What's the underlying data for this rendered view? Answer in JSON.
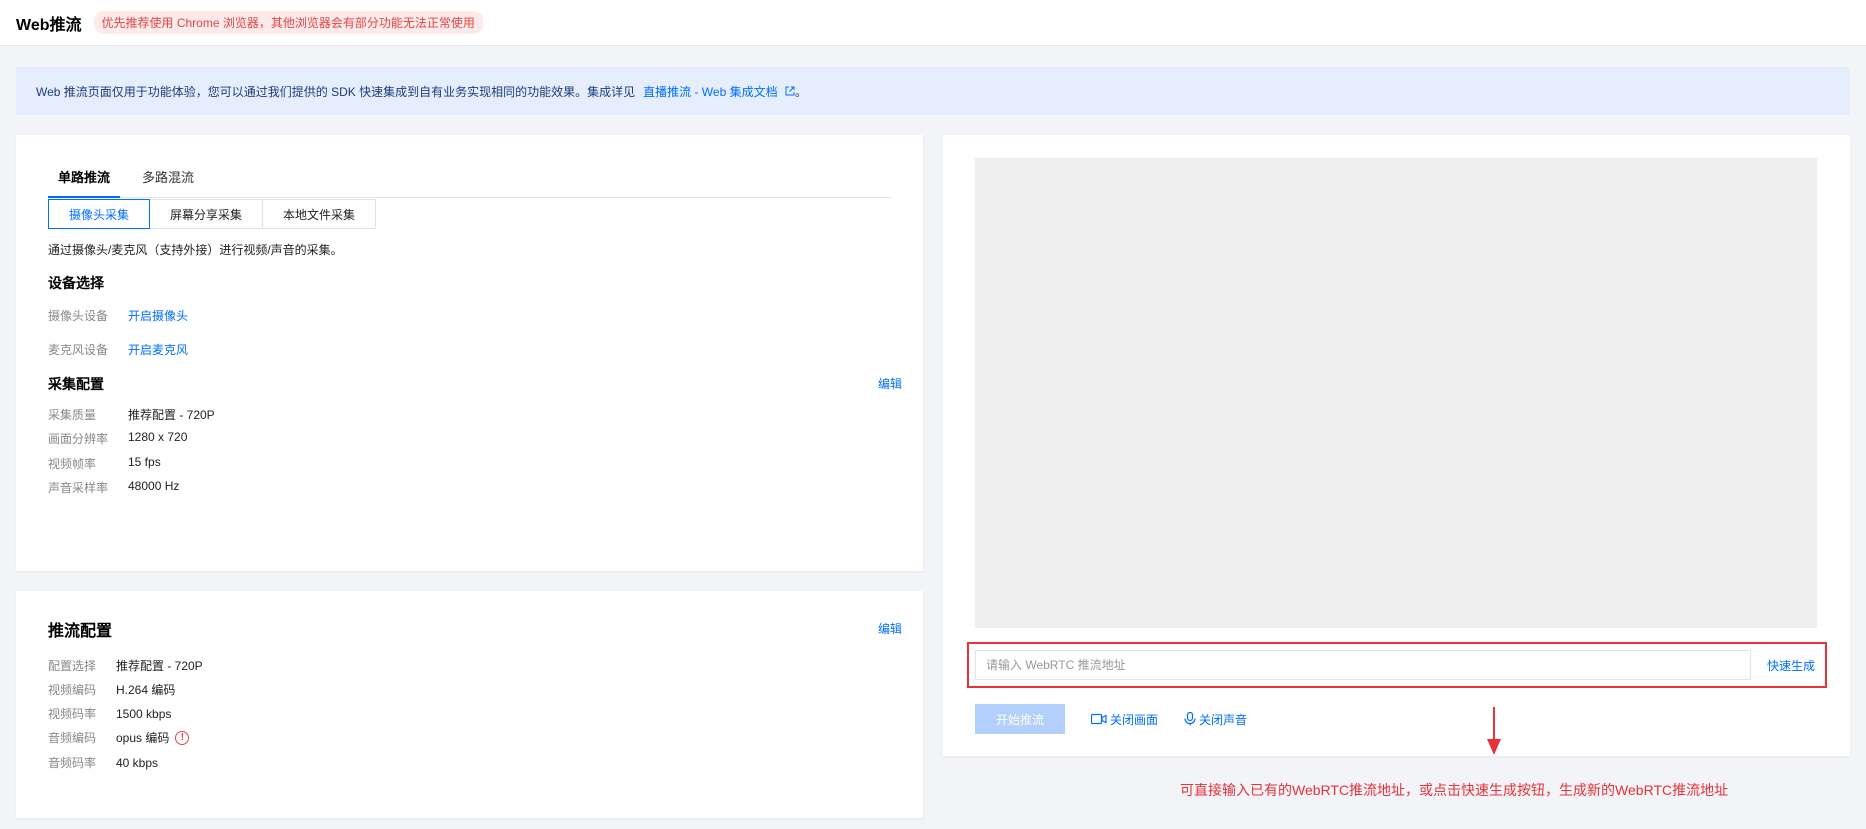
{
  "header": {
    "title": "Web推流",
    "warning": "优先推荐使用 Chrome 浏览器，其他浏览器会有部分功能无法正常使用"
  },
  "notice": {
    "text": "Web 推流页面仅用于功能体验，您可以通过我们提供的 SDK 快速集成到自有业务实现相同的功能效果。集成详见",
    "link": "直播推流 - Web 集成文档",
    "suffix": "。"
  },
  "tabs": [
    {
      "label": "单路推流",
      "active": true
    },
    {
      "label": "多路混流",
      "active": false
    }
  ],
  "capture_modes": [
    {
      "label": "摄像头采集",
      "active": true
    },
    {
      "label": "屏幕分享采集",
      "active": false
    },
    {
      "label": "本地文件采集",
      "active": false
    }
  ],
  "capture_desc": "通过摄像头/麦克风（支持外接）进行视频/声音的采集。",
  "device": {
    "title": "设备选择",
    "camera_label": "摄像头设备",
    "camera_action": "开启摄像头",
    "mic_label": "麦克风设备",
    "mic_action": "开启麦克风"
  },
  "capture_config": {
    "title": "采集配置",
    "edit": "编辑",
    "rows": [
      {
        "label": "采集质量",
        "value": "推荐配置 - 720P"
      },
      {
        "label": "画面分辨率",
        "value": "1280 x 720"
      },
      {
        "label": "视频帧率",
        "value": "15 fps"
      },
      {
        "label": "声音采样率",
        "value": "48000 Hz"
      }
    ]
  },
  "push_config": {
    "title": "推流配置",
    "edit": "编辑",
    "rows": [
      {
        "label": "配置选择",
        "value": "推荐配置 - 720P"
      },
      {
        "label": "视频编码",
        "value": "H.264 编码"
      },
      {
        "label": "视频码率",
        "value": "1500 kbps"
      },
      {
        "label": "音频编码",
        "value": "opus 编码"
      },
      {
        "label": "音频码率",
        "value": "40 kbps"
      }
    ]
  },
  "player": {
    "url_placeholder": "请输入 WebRTC 推流地址",
    "quick_generate": "快速生成",
    "start_push": "开始推流",
    "close_video": "关闭画面",
    "close_audio": "关闭声音"
  },
  "annotation": "可直接输入已有的WebRTC推流地址，或点击快速生成按钮，生成新的WebRTC推流地址",
  "colors": {
    "accent": "#006eff",
    "warning": "#e54545",
    "annotation": "#e5323b",
    "disabled_button": "#b2d0fb"
  }
}
